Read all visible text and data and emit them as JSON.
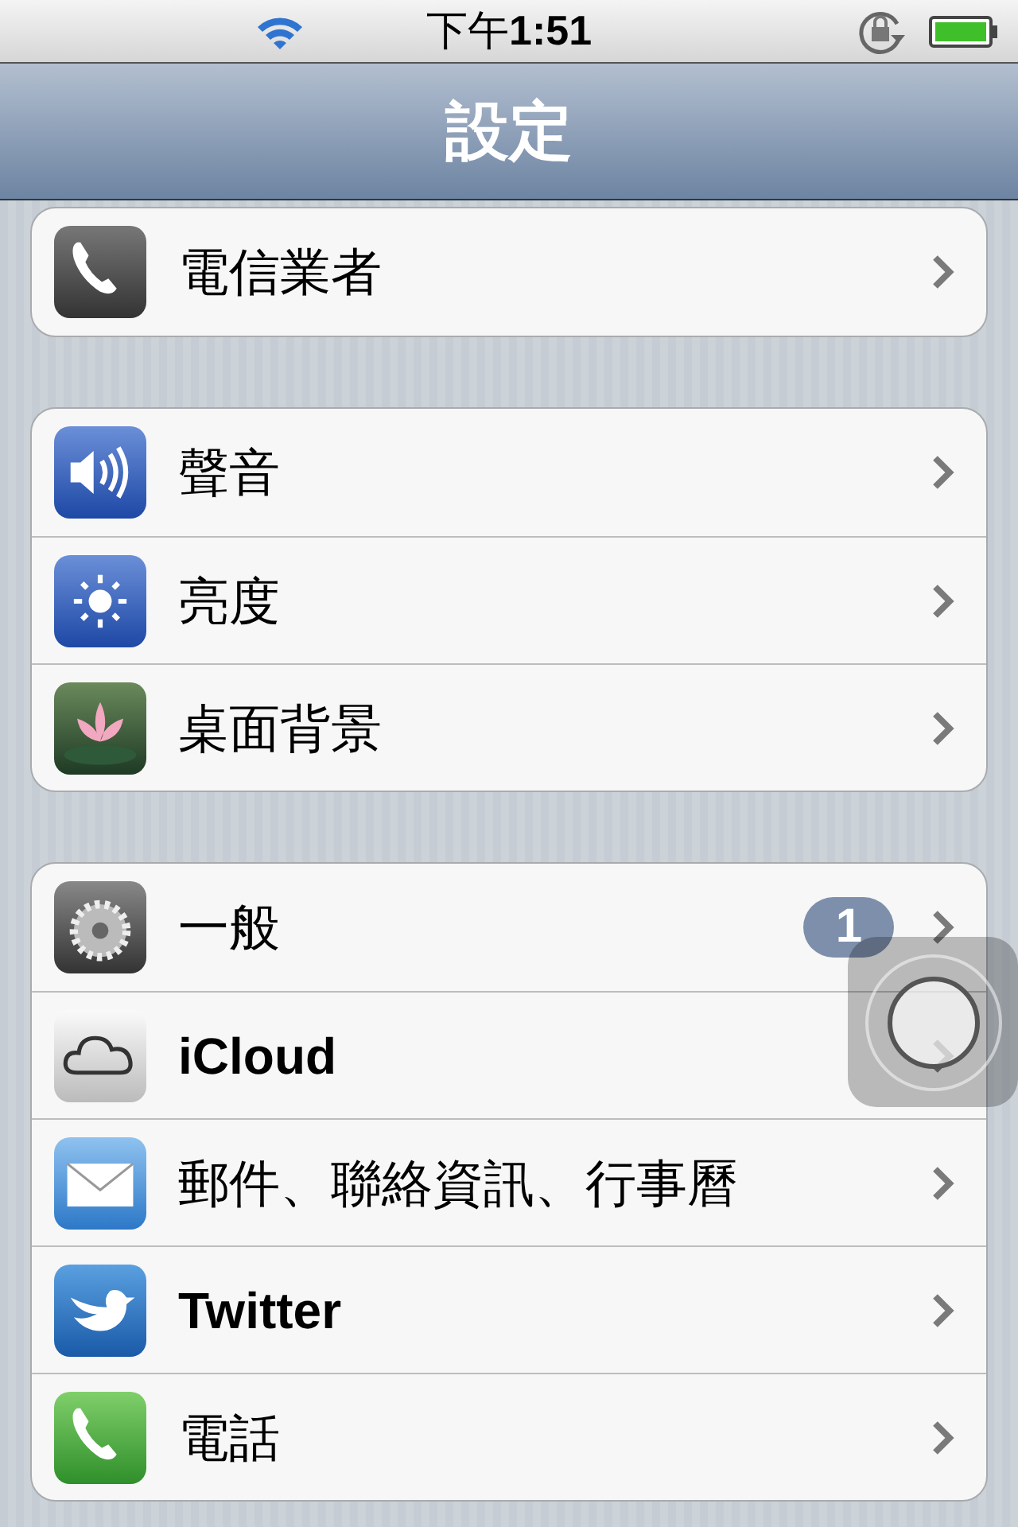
{
  "status_bar": {
    "time": "下午**1:51**"
  },
  "nav_bar": {
    "title": "設定"
  },
  "groups": [
    [
      {
        "label": "電信業者",
        "bold": false
      }
    ],
    [
      {
        "label": "聲音",
        "bold": false
      },
      {
        "label": "亮度",
        "bold": false
      },
      {
        "label": "桌面背景",
        "bold": false
      }
    ],
    [
      {
        "label": "一般",
        "bold": false,
        "badge": "1"
      },
      {
        "label": "iCloud",
        "bold": true
      },
      {
        "label": "郵件、聯絡資訊、行事曆",
        "bold": false
      },
      {
        "label": "Twitter",
        "bold": true
      },
      {
        "label": "電話",
        "bold": false
      }
    ]
  ]
}
